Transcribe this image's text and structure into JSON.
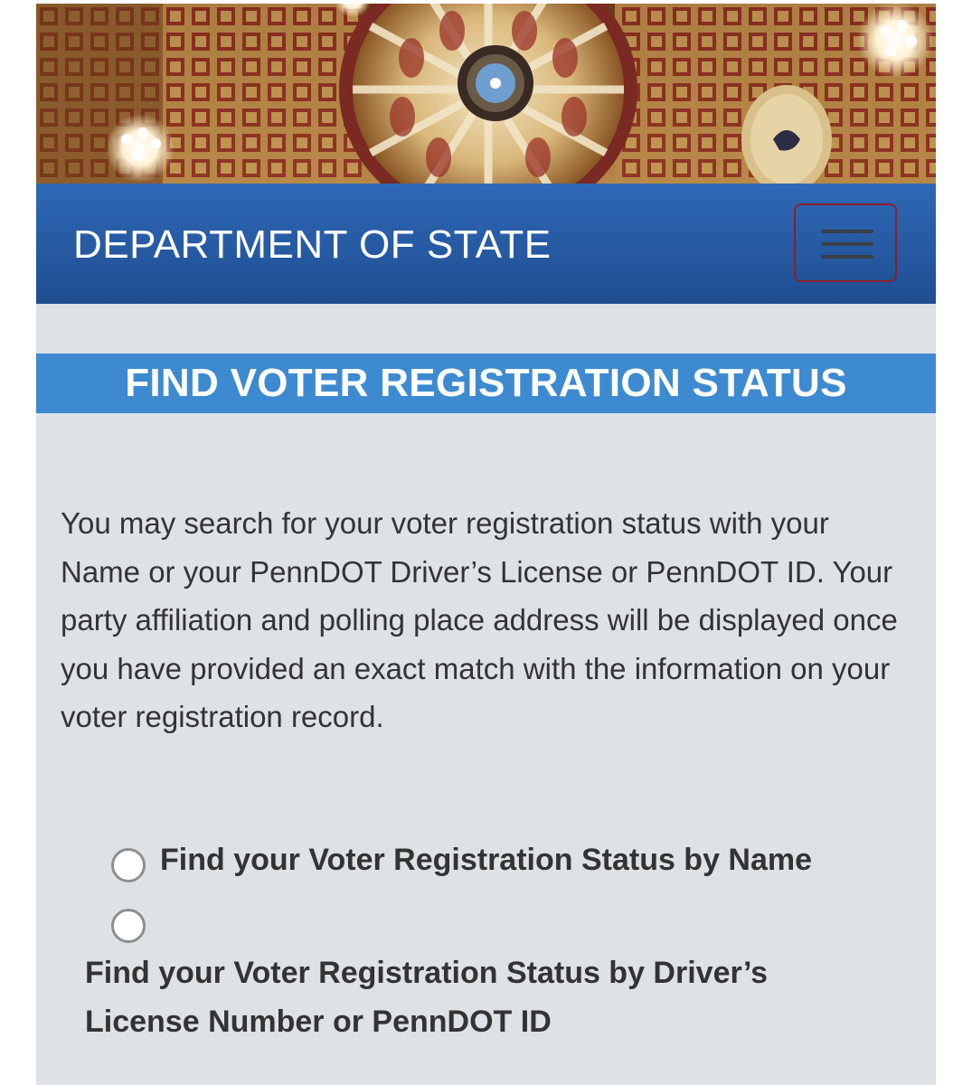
{
  "banner": {
    "image_name": "capitol-rotunda-dome-image"
  },
  "header": {
    "title": "DEPARTMENT OF STATE",
    "menu_icon": "hamburger-menu-icon",
    "background_color": "#265aa2",
    "toggle_border_color": "#8a1f2b"
  },
  "section": {
    "title": "FIND VOTER REGISTRATION STATUS",
    "background_color": "#3d8ad0"
  },
  "description": "You may search for your voter registration status with your Name or your PennDOT Driver’s License or PennDOT ID. Your party affiliation and polling place address will be displayed once you have provided an exact match with the information on your voter registration record.",
  "search_options": [
    {
      "label": "Find your Voter Registration Status by Name",
      "selected": false
    },
    {
      "label": "Find your Voter Registration Status by Driver’s License Number or PennDOT ID",
      "selected": false
    }
  ],
  "colors": {
    "page_background": "#dde2e7",
    "text": "#333333"
  }
}
